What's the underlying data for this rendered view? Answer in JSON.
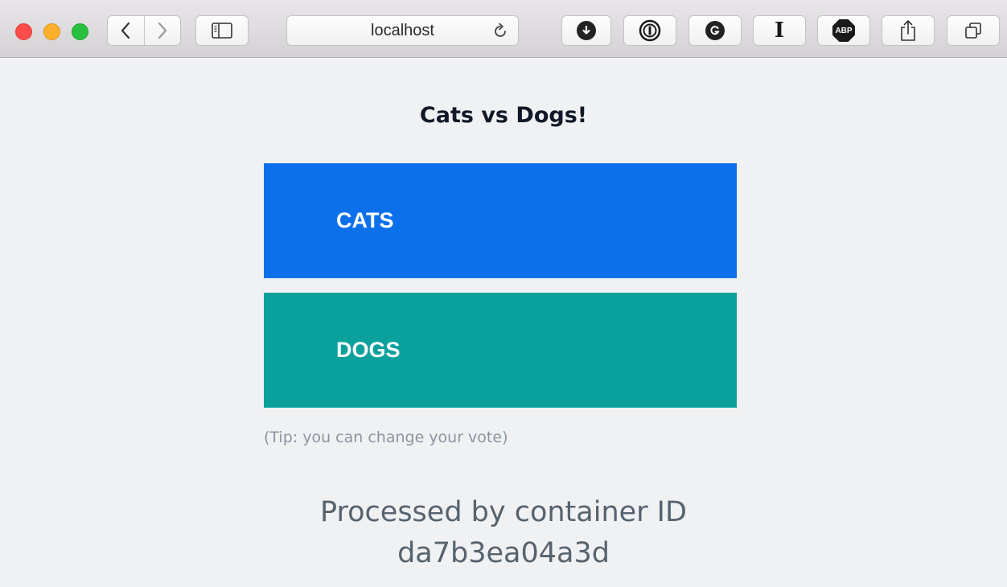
{
  "browser": {
    "address": "localhost",
    "icons": {
      "back": "chevron-left-icon",
      "forward": "chevron-right-icon",
      "sidebar": "sidebar-icon",
      "reload": "reload-icon",
      "download": "download-icon",
      "onepassword": "onepassword-icon",
      "grammarly": "grammarly-icon",
      "instapaper": "instapaper-icon",
      "adblock": "adblock-plus-icon",
      "share": "share-icon",
      "tabs": "tabs-overview-icon"
    },
    "adblock_label": "ABP",
    "instapaper_label": "I"
  },
  "page": {
    "title": "Cats vs Dogs!",
    "options": [
      {
        "label": "CATS",
        "color": "#0c70eb"
      },
      {
        "label": "DOGS",
        "color": "#0aa09c"
      }
    ],
    "tip": "(Tip: you can change your vote)",
    "processed_line1": "Processed by container ID",
    "processed_line2": "da7b3ea04a3d"
  },
  "colors": {
    "background": "#f0f1f3",
    "title": "#111827",
    "tip": "#8a95a2",
    "processed": "#56636f"
  }
}
